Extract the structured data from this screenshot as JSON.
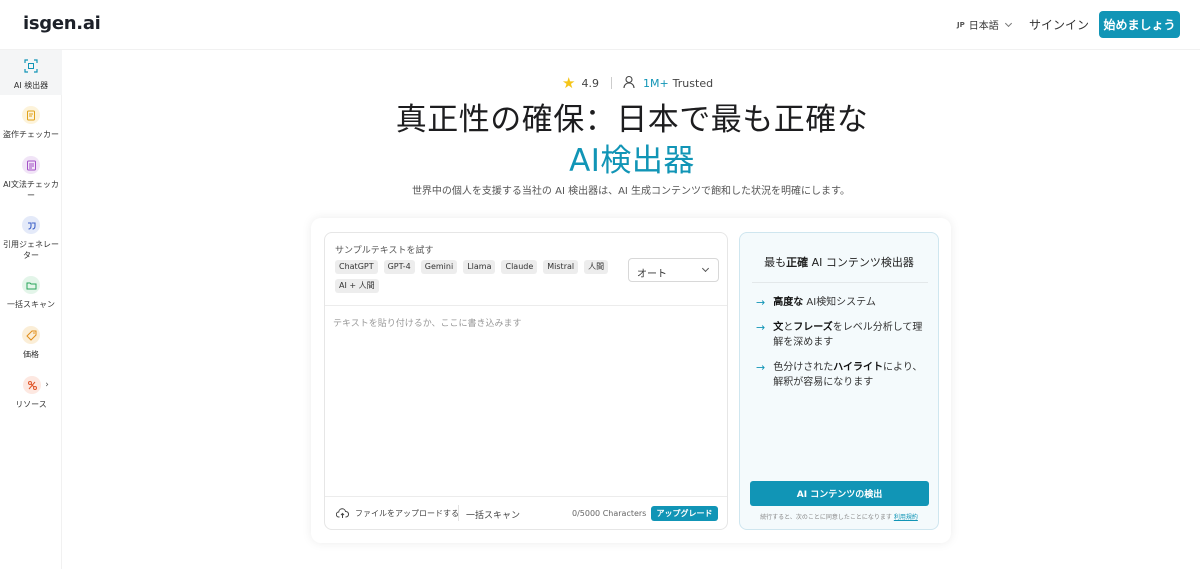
{
  "header": {
    "logo": "isgen.ai",
    "lang_code": "JP",
    "lang_label": "日本語",
    "signin": "サインイン",
    "start_button": "始めましょう"
  },
  "sidebar": {
    "items": [
      {
        "label": "AI 検出器",
        "icon": "ai-detector-icon",
        "active": true
      },
      {
        "label": "盗作チェッカー",
        "icon": "plagiarism-icon"
      },
      {
        "label": "AI文法チェッカー",
        "icon": "grammar-icon"
      },
      {
        "label": "引用ジェネレーター",
        "icon": "citation-icon"
      },
      {
        "label": "一括スキャン",
        "icon": "folder-icon"
      },
      {
        "label": "価格",
        "icon": "price-tag-icon"
      },
      {
        "label": "リソース",
        "icon": "resources-icon"
      }
    ]
  },
  "hero": {
    "rating": "4.9",
    "users": "1M+",
    "trusted": "Trusted",
    "title_line1": "真正性の確保：日本で最も正確な",
    "title_line2": "AI検出器",
    "subtitle": "世界中の個人を支援する当社の AI 検出器は、AI 生成コンテンツで飽和した状況を明確にします。"
  },
  "editor": {
    "sample_label": "サンプルテキストを試す",
    "chips": [
      "ChatGPT",
      "GPT-4",
      "Gemini",
      "Llama",
      "Claude",
      "Mistral",
      "人間",
      "AI + 人間"
    ],
    "select_value": "オート",
    "placeholder": "テキストを貼り付けるか、ここに書き込みます",
    "upload_label": "ファイルをアップロードする",
    "bulk_scan": "一括スキャン",
    "char_count": "0/5000 Characters",
    "upgrade": "アップグレード"
  },
  "panel": {
    "title_prefix": "最も",
    "title_bold": "正確",
    "title_suffix": " AI コンテンツ検出器",
    "feature1_bold": "高度な",
    "feature1_rest": " AI検知システム",
    "feature2_b1": "文",
    "feature2_t1": "と",
    "feature2_b2": "フレーズ",
    "feature2_t2": "をレベル分析して理解を深めます",
    "feature3_t1": "色分けされた",
    "feature3_b1": "ハイライト",
    "feature3_t2": "により、解釈が容易になります",
    "detect_button": "AI コンテンツの検出",
    "terms_text": "続行すると、次のことに同意したことになります",
    "terms_link": "利用規約"
  },
  "colors": {
    "accent": "#1195b6"
  }
}
